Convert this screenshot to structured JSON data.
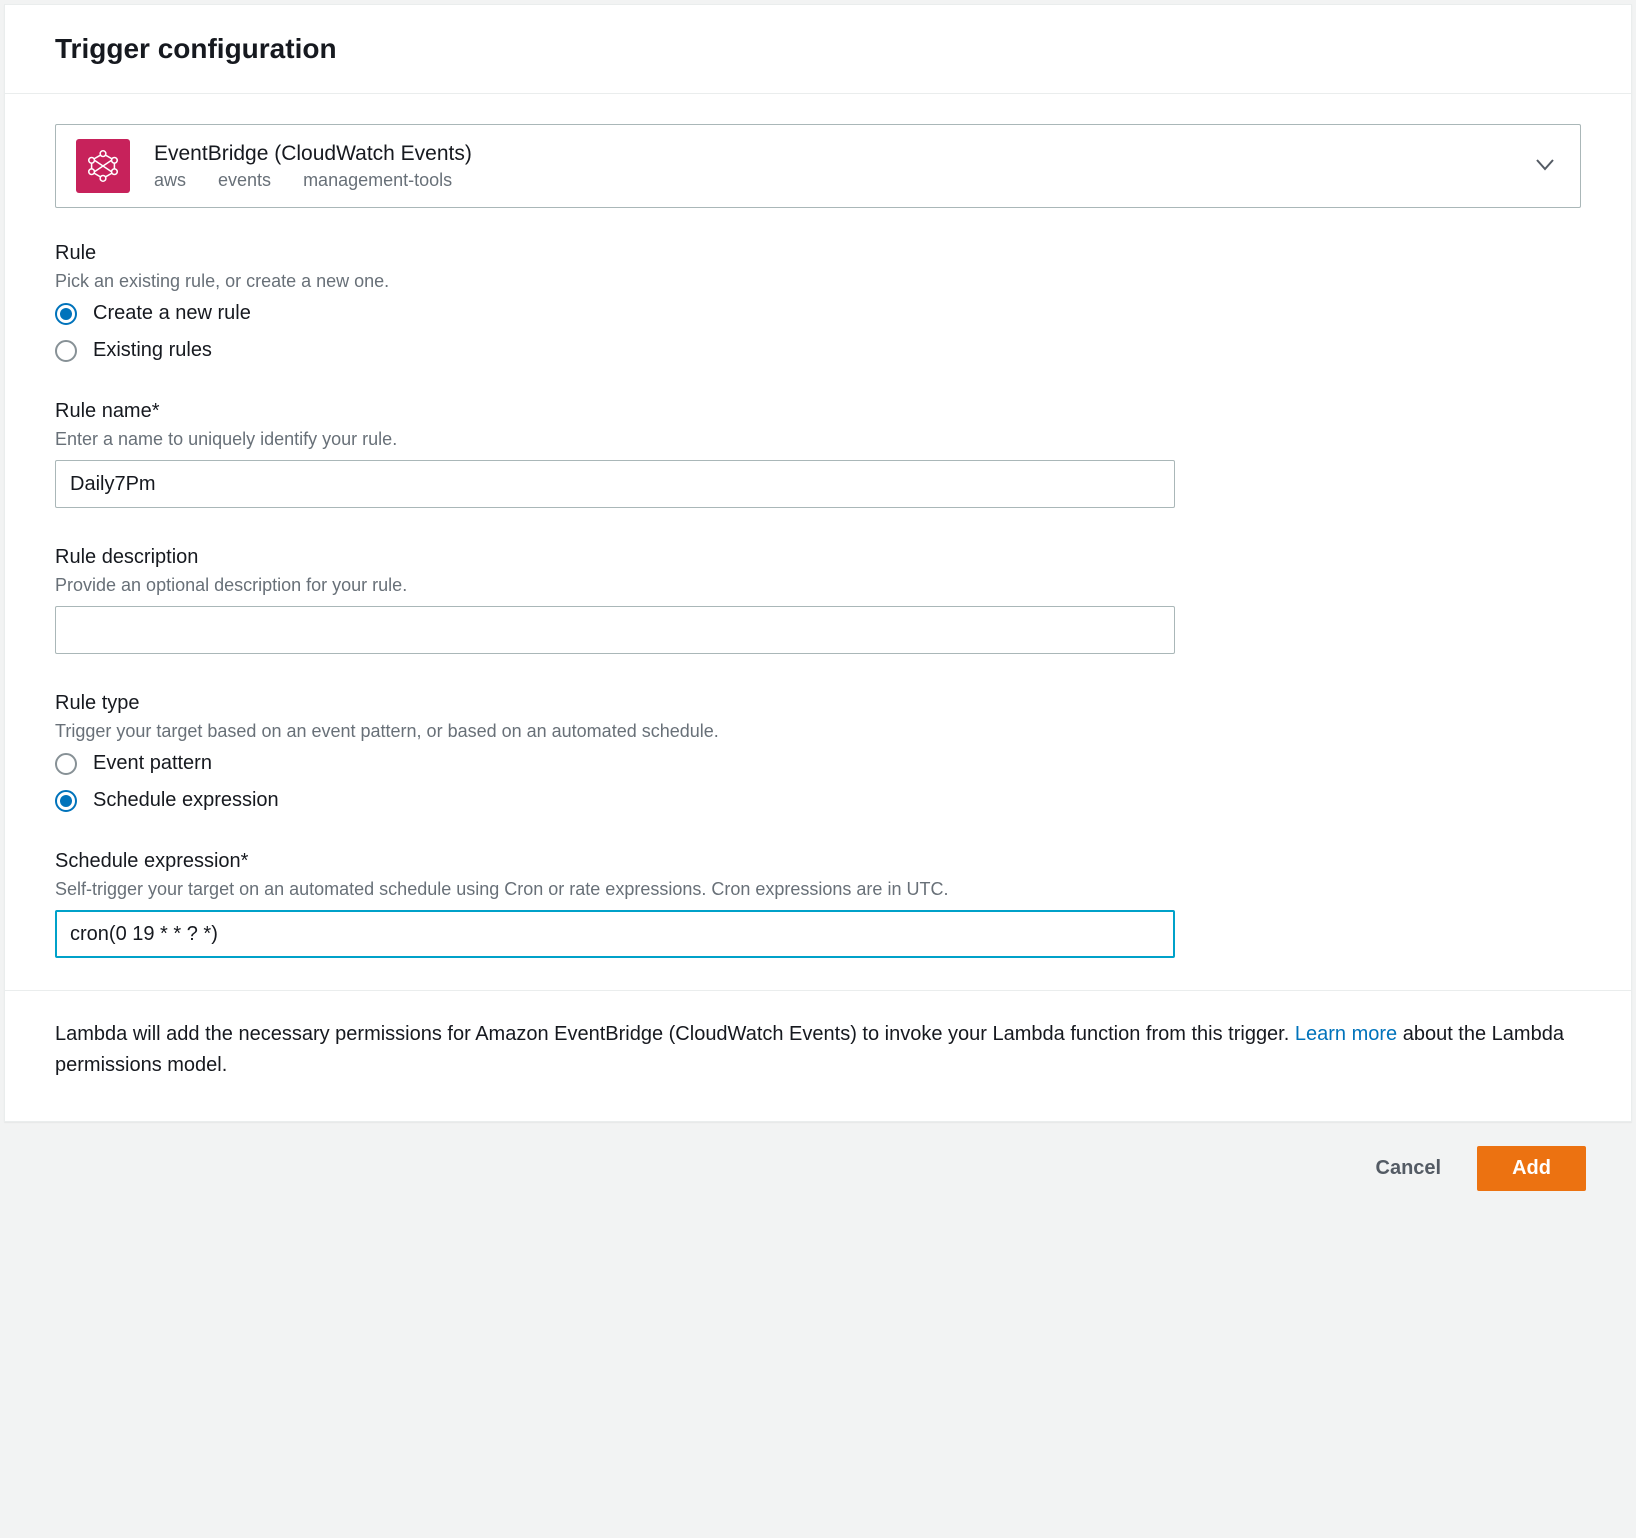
{
  "header": {
    "title": "Trigger configuration"
  },
  "source_select": {
    "title": "EventBridge (CloudWatch Events)",
    "tags": [
      "aws",
      "events",
      "management-tools"
    ]
  },
  "rule": {
    "label": "Rule",
    "hint": "Pick an existing rule, or create a new one.",
    "options": {
      "create": "Create a new rule",
      "existing": "Existing rules"
    }
  },
  "rule_name": {
    "label": "Rule name*",
    "hint": "Enter a name to uniquely identify your rule.",
    "value": "Daily7Pm"
  },
  "rule_description": {
    "label": "Rule description",
    "hint": "Provide an optional description for your rule.",
    "value": ""
  },
  "rule_type": {
    "label": "Rule type",
    "hint": "Trigger your target based on an event pattern, or based on an automated schedule.",
    "options": {
      "event_pattern": "Event pattern",
      "schedule": "Schedule expression"
    }
  },
  "schedule_expression": {
    "label": "Schedule expression*",
    "hint": "Self-trigger your target on an automated schedule using Cron or rate expressions. Cron expressions are in UTC.",
    "value": "cron(0 19 * * ? *)"
  },
  "permissions": {
    "text_before": "Lambda will add the necessary permissions for Amazon EventBridge (CloudWatch Events) to invoke your Lambda function from this trigger. ",
    "link_text": "Learn more",
    "text_after": " about the Lambda permissions model."
  },
  "footer": {
    "cancel": "Cancel",
    "add": "Add"
  }
}
